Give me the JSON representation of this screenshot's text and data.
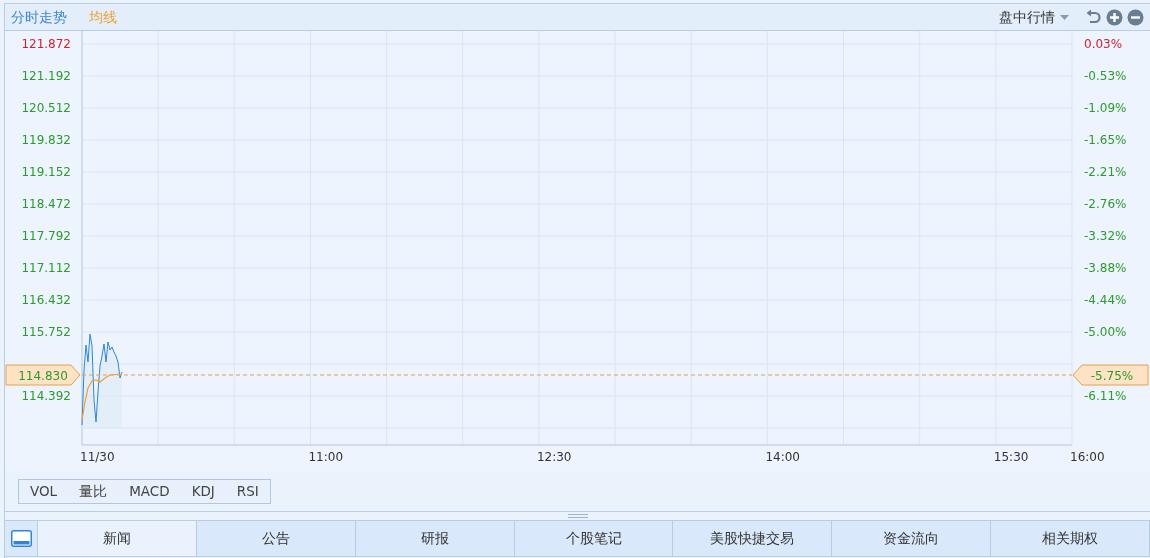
{
  "header": {
    "tabs": [
      {
        "label": "分时走势",
        "kind": "title"
      },
      {
        "label": "均线",
        "kind": "average"
      }
    ],
    "menu": "盘中行情"
  },
  "chart": {
    "price_labels": [
      {
        "text": "121.872",
        "color": "#d2222d"
      },
      {
        "text": "121.192",
        "color": "#2c9a2c"
      },
      {
        "text": "120.512",
        "color": "#2c9a2c"
      },
      {
        "text": "119.832",
        "color": "#2c9a2c"
      },
      {
        "text": "119.152",
        "color": "#2c9a2c"
      },
      {
        "text": "118.472",
        "color": "#2c9a2c"
      },
      {
        "text": "117.792",
        "color": "#2c9a2c"
      },
      {
        "text": "117.112",
        "color": "#2c9a2c"
      },
      {
        "text": "116.432",
        "color": "#2c9a2c"
      },
      {
        "text": "115.752",
        "color": "#2c9a2c"
      },
      {
        "text": "114.392",
        "color": "#2c9a2c"
      }
    ],
    "percent_labels": [
      {
        "text": "0.03%",
        "color": "#d2222d"
      },
      {
        "text": "-0.53%",
        "color": "#2c9a2c"
      },
      {
        "text": "-1.09%",
        "color": "#2c9a2c"
      },
      {
        "text": "-1.65%",
        "color": "#2c9a2c"
      },
      {
        "text": "-2.21%",
        "color": "#2c9a2c"
      },
      {
        "text": "-2.76%",
        "color": "#2c9a2c"
      },
      {
        "text": "-3.32%",
        "color": "#2c9a2c"
      },
      {
        "text": "-3.88%",
        "color": "#2c9a2c"
      },
      {
        "text": "-4.44%",
        "color": "#2c9a2c"
      },
      {
        "text": "-5.00%",
        "color": "#2c9a2c"
      },
      {
        "text": "-6.11%",
        "color": "#2c9a2c"
      }
    ],
    "time_labels": [
      "11/30",
      "11:00",
      "12:30",
      "14:00",
      "15:30",
      "16:00"
    ],
    "current": {
      "price": "114.830",
      "percent": "-5.75%",
      "color": "#2c9a2c"
    }
  },
  "indicators": [
    "VOL",
    "量比",
    "MACD",
    "KDJ",
    "RSI"
  ],
  "bottom_tabs": [
    {
      "label": "新闻",
      "selected": true
    },
    {
      "label": "公告",
      "selected": false
    },
    {
      "label": "研报",
      "selected": false
    },
    {
      "label": "个股笔记",
      "selected": false
    },
    {
      "label": "美股快捷交易",
      "selected": false
    },
    {
      "label": "资金流向",
      "selected": false
    },
    {
      "label": "相关期权",
      "selected": false
    }
  ]
}
